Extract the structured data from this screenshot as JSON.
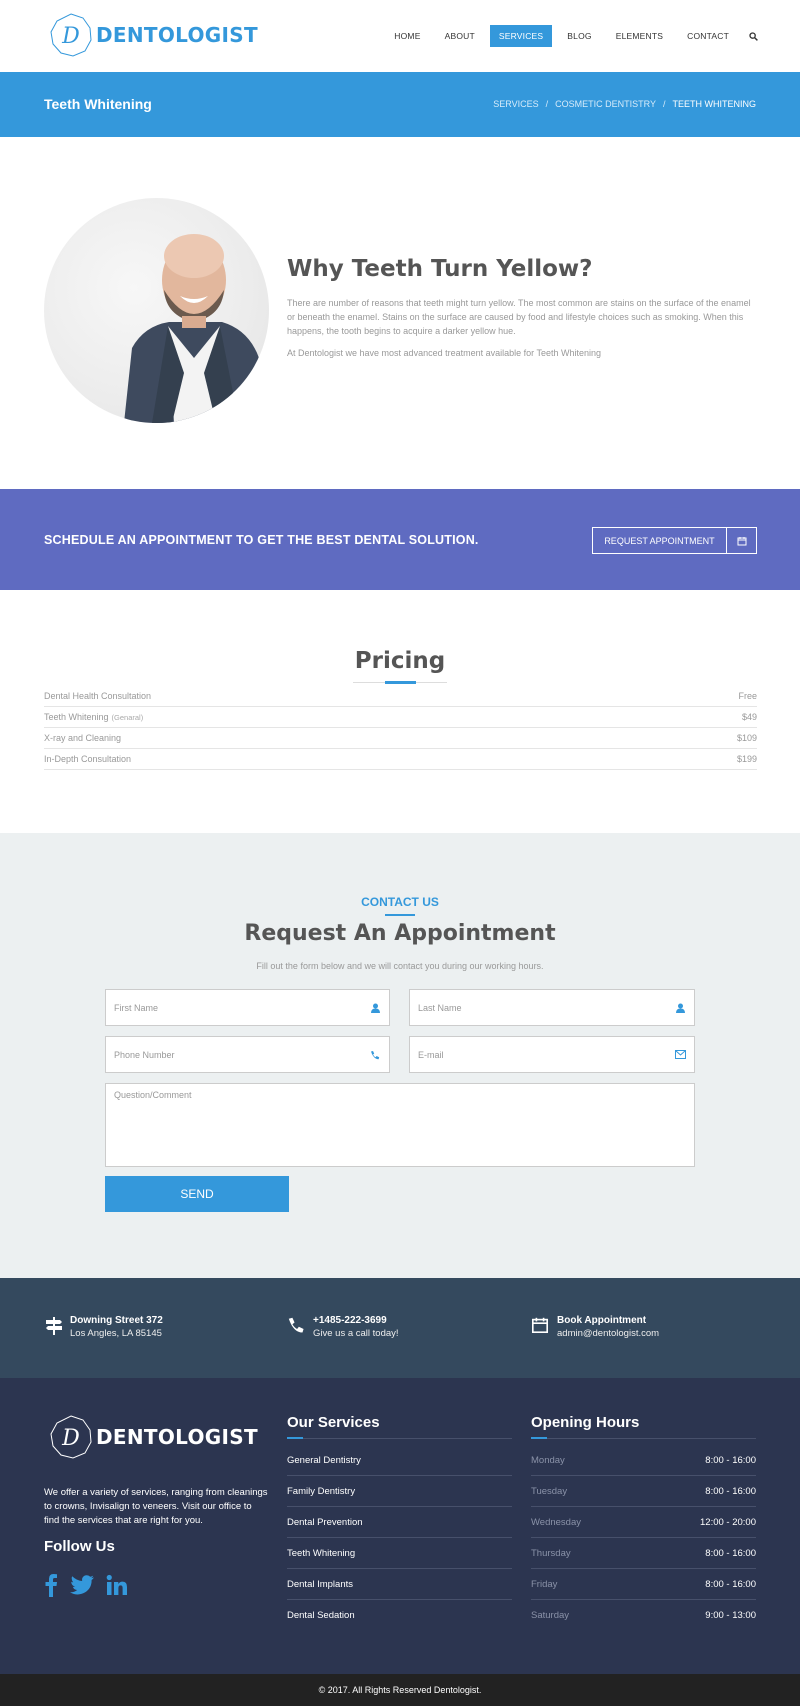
{
  "brand": {
    "name": "DENTOLOGIST",
    "initial": "D"
  },
  "nav": {
    "items": [
      {
        "label": "HOME"
      },
      {
        "label": "ABOUT"
      },
      {
        "label": "SERVICES"
      },
      {
        "label": "BLOG"
      },
      {
        "label": "ELEMENTS"
      },
      {
        "label": "CONTACT"
      }
    ],
    "active_index": 2,
    "search_icon": "search-icon"
  },
  "page_header": {
    "title": "Teeth Whitening",
    "breadcrumb": [
      "SERVICES",
      "COSMETIC DENTISTRY",
      "TEETH WHITENING"
    ]
  },
  "hero": {
    "title": "Why Teeth Turn Yellow?",
    "paragraph_1": "There are number of reasons that teeth might turn yellow. The most common are stains on the surface of the enamel or beneath the enamel. Stains on the surface are caused by food and lifestyle choices such as smoking. When this happens, the tooth begins to acquire a darker yellow hue.",
    "paragraph_2": "At Dentologist we have most advanced treatment available for Teeth Whitening"
  },
  "cta": {
    "text": "SCHEDULE AN APPOINTMENT TO GET THE BEST DENTAL SOLUTION.",
    "button_label": "REQUEST APPOINTMENT",
    "button_icon": "calendar-icon"
  },
  "pricing": {
    "title": "Pricing",
    "rows": [
      {
        "name": "Dental Health Consultation",
        "qualifier": "",
        "price": "Free"
      },
      {
        "name": "Teeth Whitening",
        "qualifier": "(Genaral)",
        "price": "$49"
      },
      {
        "name": "X-ray and Cleaning",
        "qualifier": "",
        "price": "$109"
      },
      {
        "name": "In-Depth Consultation",
        "qualifier": "",
        "price": "$199"
      }
    ]
  },
  "appointment": {
    "kicker": "CONTACT US",
    "title": "Request An Appointment",
    "subtitle": "Fill out the form below and we will contact you during our working hours.",
    "first_name_placeholder": "First Name",
    "last_name_placeholder": "Last Name",
    "phone_placeholder": "Phone Number",
    "email_placeholder": "E-mail",
    "comment_placeholder": "Question/Comment",
    "send_label": "SEND"
  },
  "info_strip": {
    "address": {
      "main": "Downing Street 372",
      "sub": "Los Angles, LA 85145",
      "icon": "signpost-icon"
    },
    "phone": {
      "main": "+1485-222-3699",
      "sub": "Give us a call today!",
      "icon": "phone-icon"
    },
    "booking": {
      "main": "Book Appointment",
      "sub": "admin@dentologist.com",
      "icon": "calendar-icon"
    }
  },
  "footer": {
    "about": "We offer a variety of services, ranging from cleanings to crowns, Invisalign to veneers. Visit our office to find the services that are right for you.",
    "follow_title": "Follow Us",
    "social": [
      "facebook-icon",
      "twitter-icon",
      "linkedin-icon"
    ],
    "services_title": "Our Services",
    "services": [
      "General Dentistry",
      "Family Dentistry",
      "Dental Prevention",
      "Teeth Whitening",
      "Dental Implants",
      "Dental Sedation"
    ],
    "hours_title": "Opening Hours",
    "hours": [
      {
        "day": "Monday",
        "time": "8:00 - 16:00"
      },
      {
        "day": "Tuesday",
        "time": "8:00 - 16:00"
      },
      {
        "day": "Wednesday",
        "time": "12:00 - 20:00"
      },
      {
        "day": "Thursday",
        "time": "8:00 - 16:00"
      },
      {
        "day": "Friday",
        "time": "8:00 - 16:00"
      },
      {
        "day": "Saturday",
        "time": "9:00 - 13:00"
      }
    ],
    "copyright": "© 2017. All Rights Reserved Dentologist."
  },
  "colors": {
    "accent": "#3498db",
    "cta_band": "#5f6bc1",
    "form_bg": "#ecf0f1",
    "info_strip": "#34495e",
    "footer": "#2c3550",
    "copyright_bar": "#222222"
  }
}
